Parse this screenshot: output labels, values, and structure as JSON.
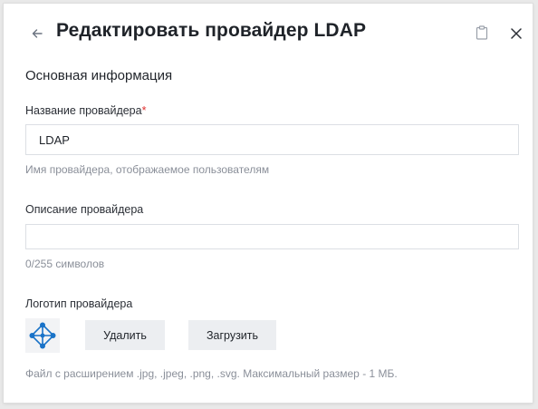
{
  "dialog": {
    "title": "Редактировать провайдер LDAP",
    "back_icon": "arrow-left-icon",
    "clipboard_icon": "clipboard-icon",
    "close_icon": "close-icon"
  },
  "section": {
    "title": "Основная информация"
  },
  "provider_name": {
    "label": "Название провайдера",
    "required_mark": "*",
    "value": "LDAP",
    "hint": "Имя провайдера, отображаемое пользователям"
  },
  "provider_description": {
    "label": "Описание провайдера",
    "value": "",
    "counter": "0/255 символов"
  },
  "provider_logo": {
    "label": "Логотип провайдера",
    "logo_icon": "ldap-logo-icon",
    "logo_color": "#1a73c8",
    "delete_label": "Удалить",
    "upload_label": "Загрузить",
    "hint": "Файл с расширением .jpg, .jpeg, .png, .svg. Максимальный размер - 1 МБ."
  }
}
